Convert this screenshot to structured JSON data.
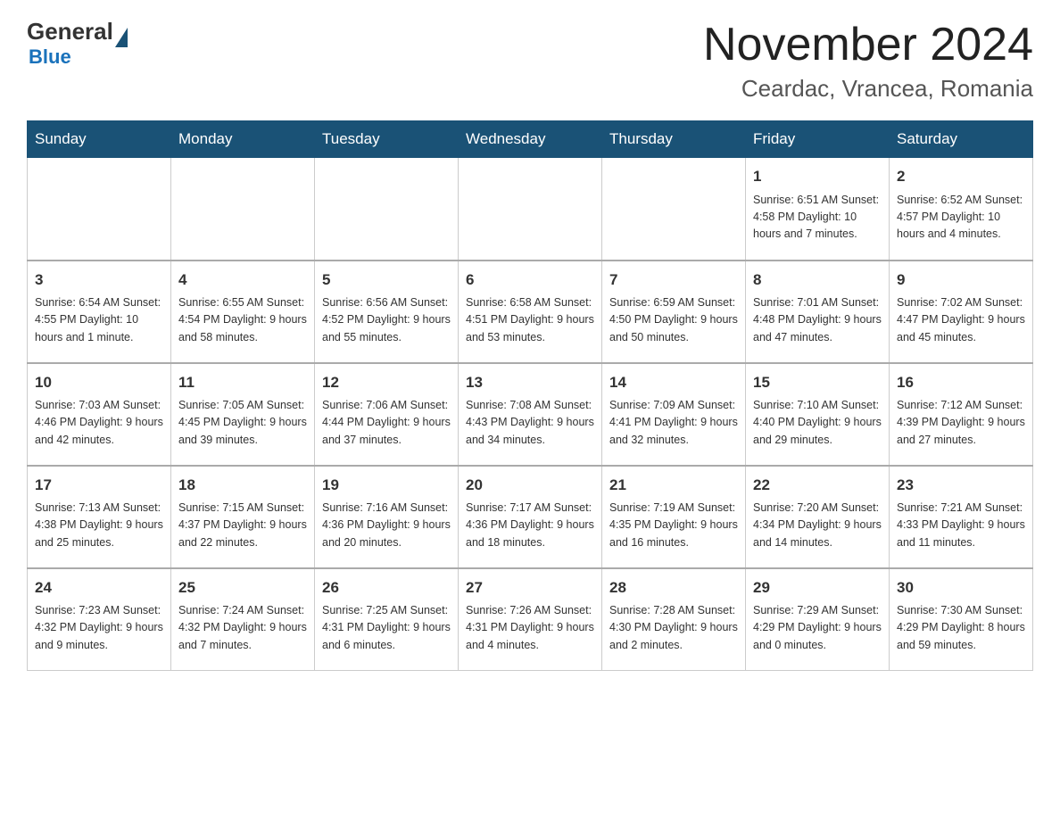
{
  "header": {
    "logo_general": "General",
    "logo_blue": "Blue",
    "month_title": "November 2024",
    "location": "Ceardac, Vrancea, Romania"
  },
  "days_of_week": [
    "Sunday",
    "Monday",
    "Tuesday",
    "Wednesday",
    "Thursday",
    "Friday",
    "Saturday"
  ],
  "weeks": [
    [
      {
        "day": "",
        "info": ""
      },
      {
        "day": "",
        "info": ""
      },
      {
        "day": "",
        "info": ""
      },
      {
        "day": "",
        "info": ""
      },
      {
        "day": "",
        "info": ""
      },
      {
        "day": "1",
        "info": "Sunrise: 6:51 AM\nSunset: 4:58 PM\nDaylight: 10 hours and 7 minutes."
      },
      {
        "day": "2",
        "info": "Sunrise: 6:52 AM\nSunset: 4:57 PM\nDaylight: 10 hours and 4 minutes."
      }
    ],
    [
      {
        "day": "3",
        "info": "Sunrise: 6:54 AM\nSunset: 4:55 PM\nDaylight: 10 hours and 1 minute."
      },
      {
        "day": "4",
        "info": "Sunrise: 6:55 AM\nSunset: 4:54 PM\nDaylight: 9 hours and 58 minutes."
      },
      {
        "day": "5",
        "info": "Sunrise: 6:56 AM\nSunset: 4:52 PM\nDaylight: 9 hours and 55 minutes."
      },
      {
        "day": "6",
        "info": "Sunrise: 6:58 AM\nSunset: 4:51 PM\nDaylight: 9 hours and 53 minutes."
      },
      {
        "day": "7",
        "info": "Sunrise: 6:59 AM\nSunset: 4:50 PM\nDaylight: 9 hours and 50 minutes."
      },
      {
        "day": "8",
        "info": "Sunrise: 7:01 AM\nSunset: 4:48 PM\nDaylight: 9 hours and 47 minutes."
      },
      {
        "day": "9",
        "info": "Sunrise: 7:02 AM\nSunset: 4:47 PM\nDaylight: 9 hours and 45 minutes."
      }
    ],
    [
      {
        "day": "10",
        "info": "Sunrise: 7:03 AM\nSunset: 4:46 PM\nDaylight: 9 hours and 42 minutes."
      },
      {
        "day": "11",
        "info": "Sunrise: 7:05 AM\nSunset: 4:45 PM\nDaylight: 9 hours and 39 minutes."
      },
      {
        "day": "12",
        "info": "Sunrise: 7:06 AM\nSunset: 4:44 PM\nDaylight: 9 hours and 37 minutes."
      },
      {
        "day": "13",
        "info": "Sunrise: 7:08 AM\nSunset: 4:43 PM\nDaylight: 9 hours and 34 minutes."
      },
      {
        "day": "14",
        "info": "Sunrise: 7:09 AM\nSunset: 4:41 PM\nDaylight: 9 hours and 32 minutes."
      },
      {
        "day": "15",
        "info": "Sunrise: 7:10 AM\nSunset: 4:40 PM\nDaylight: 9 hours and 29 minutes."
      },
      {
        "day": "16",
        "info": "Sunrise: 7:12 AM\nSunset: 4:39 PM\nDaylight: 9 hours and 27 minutes."
      }
    ],
    [
      {
        "day": "17",
        "info": "Sunrise: 7:13 AM\nSunset: 4:38 PM\nDaylight: 9 hours and 25 minutes."
      },
      {
        "day": "18",
        "info": "Sunrise: 7:15 AM\nSunset: 4:37 PM\nDaylight: 9 hours and 22 minutes."
      },
      {
        "day": "19",
        "info": "Sunrise: 7:16 AM\nSunset: 4:36 PM\nDaylight: 9 hours and 20 minutes."
      },
      {
        "day": "20",
        "info": "Sunrise: 7:17 AM\nSunset: 4:36 PM\nDaylight: 9 hours and 18 minutes."
      },
      {
        "day": "21",
        "info": "Sunrise: 7:19 AM\nSunset: 4:35 PM\nDaylight: 9 hours and 16 minutes."
      },
      {
        "day": "22",
        "info": "Sunrise: 7:20 AM\nSunset: 4:34 PM\nDaylight: 9 hours and 14 minutes."
      },
      {
        "day": "23",
        "info": "Sunrise: 7:21 AM\nSunset: 4:33 PM\nDaylight: 9 hours and 11 minutes."
      }
    ],
    [
      {
        "day": "24",
        "info": "Sunrise: 7:23 AM\nSunset: 4:32 PM\nDaylight: 9 hours and 9 minutes."
      },
      {
        "day": "25",
        "info": "Sunrise: 7:24 AM\nSunset: 4:32 PM\nDaylight: 9 hours and 7 minutes."
      },
      {
        "day": "26",
        "info": "Sunrise: 7:25 AM\nSunset: 4:31 PM\nDaylight: 9 hours and 6 minutes."
      },
      {
        "day": "27",
        "info": "Sunrise: 7:26 AM\nSunset: 4:31 PM\nDaylight: 9 hours and 4 minutes."
      },
      {
        "day": "28",
        "info": "Sunrise: 7:28 AM\nSunset: 4:30 PM\nDaylight: 9 hours and 2 minutes."
      },
      {
        "day": "29",
        "info": "Sunrise: 7:29 AM\nSunset: 4:29 PM\nDaylight: 9 hours and 0 minutes."
      },
      {
        "day": "30",
        "info": "Sunrise: 7:30 AM\nSunset: 4:29 PM\nDaylight: 8 hours and 59 minutes."
      }
    ]
  ]
}
